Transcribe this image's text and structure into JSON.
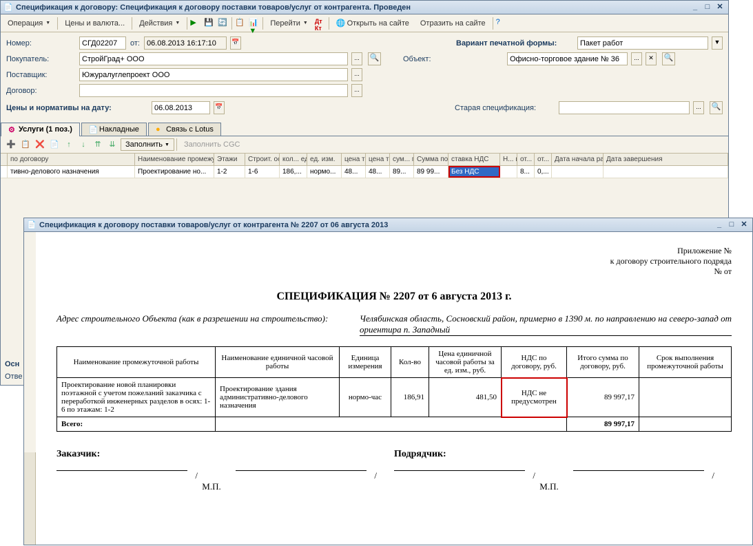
{
  "win1": {
    "title": "Спецификация к договору: Спецификация к договору поставки товаров/услуг от контрагента. Проведен",
    "toolbar": {
      "operation": "Операция",
      "prices": "Цены и валюта...",
      "actions": "Действия",
      "goto": "Перейти",
      "openSite": "Открыть на сайте",
      "reflectSite": "Отразить на сайте"
    },
    "form": {
      "numberLbl": "Номер:",
      "numberVal": "СГД02207",
      "fromLbl": "от:",
      "fromVal": "06.08.2013 16:17:10",
      "buyerLbl": "Покупатель:",
      "buyerVal": "СтройГрад+ ООО",
      "supplierLbl": "Поставщик:",
      "supplierVal": "Южуралуглепроект ООО",
      "contractLbl": "Договор:",
      "contractVal": "",
      "variantLbl": "Вариант печатной формы:",
      "variantVal": "Пакет работ",
      "objectLbl": "Объект:",
      "objectVal": "Офисно-торговое здание № 36",
      "pricesDateLbl": "Цены и нормативы на дату:",
      "pricesDateVal": "06.08.2013",
      "oldSpecLbl": "Старая спецификация:",
      "oldSpecVal": ""
    },
    "tabs": {
      "services": "Услуги (1 поз.)",
      "overhead": "Накладные",
      "lotus": "Связь с Lotus"
    },
    "sub": {
      "fill": "Заполнить",
      "fillCGC": "Заполнить CGC"
    },
    "grid": {
      "headers": [
        "по договору",
        "Наименование промежуточной",
        "Этажи",
        "Строит. оси",
        "кол... еди...",
        "ед. изм.",
        "цена тов...",
        "цена тов...",
        "сум... по",
        "Сумма по",
        "ставка НДС",
        "Н... и...",
        "от... су...",
        "от... це...",
        "Дата начала работы",
        "Дата завершения"
      ],
      "row": [
        "тивно-делового назначения",
        "Проектирование но...",
        "1-2",
        "1-6",
        "186,...",
        "нормо...",
        "48...",
        "48...",
        "89...",
        "89 99...",
        "Без НДС",
        "",
        "8...",
        "0,...",
        "",
        ""
      ]
    },
    "footer": {
      "base": "Осн",
      "resp": "Отве"
    }
  },
  "win2": {
    "title": "Спецификация к договору поставки товаров/услуг от контрагента № 2207 от 06 августа 2013",
    "print": {
      "appx1": "Приложение №",
      "appx2": "к договору строительного подряда",
      "appx3": "№ от",
      "title": "СПЕЦИФИКАЦИЯ № 2207 от 6 августа 2013 г.",
      "addrLbl": "Адрес строительного Объекта (как в разрешении на строительство):",
      "addrVal": "Челябинская область, Сосновский район, примерно в 1390 м. по направлению на северо-запад от ориентира п. Западный",
      "th1": "Наименование промежуточной работы",
      "th2": "Наименование единичной часовой работы",
      "th3": "Единица измерения",
      "th4": "Кол-во",
      "th5": "Цена единичной часовой работы за ед. изм., руб.",
      "th6": "НДС по договору, руб.",
      "th7": "Итого сумма по договору, руб.",
      "th8": "Срок выполнения промежуточной работы",
      "td1": "Проектирование новой планировки поэтажной с учетом пожеланий заказчика с переработкой инженерных разделов в осях: 1-6 по этажам: 1-2",
      "td2": "Проектирование здания административно-делового назначения",
      "td3": "нормо-час",
      "td4": "186,91",
      "td5": "481,50",
      "td6": "НДС не предусмотрен",
      "td7": "89 997,17",
      "totalLbl": "Всего:",
      "totalVal": "89 997,17",
      "customerLbl": "Заказчик:",
      "contractorLbl": "Подрядчик:",
      "mp": "М.П."
    }
  }
}
